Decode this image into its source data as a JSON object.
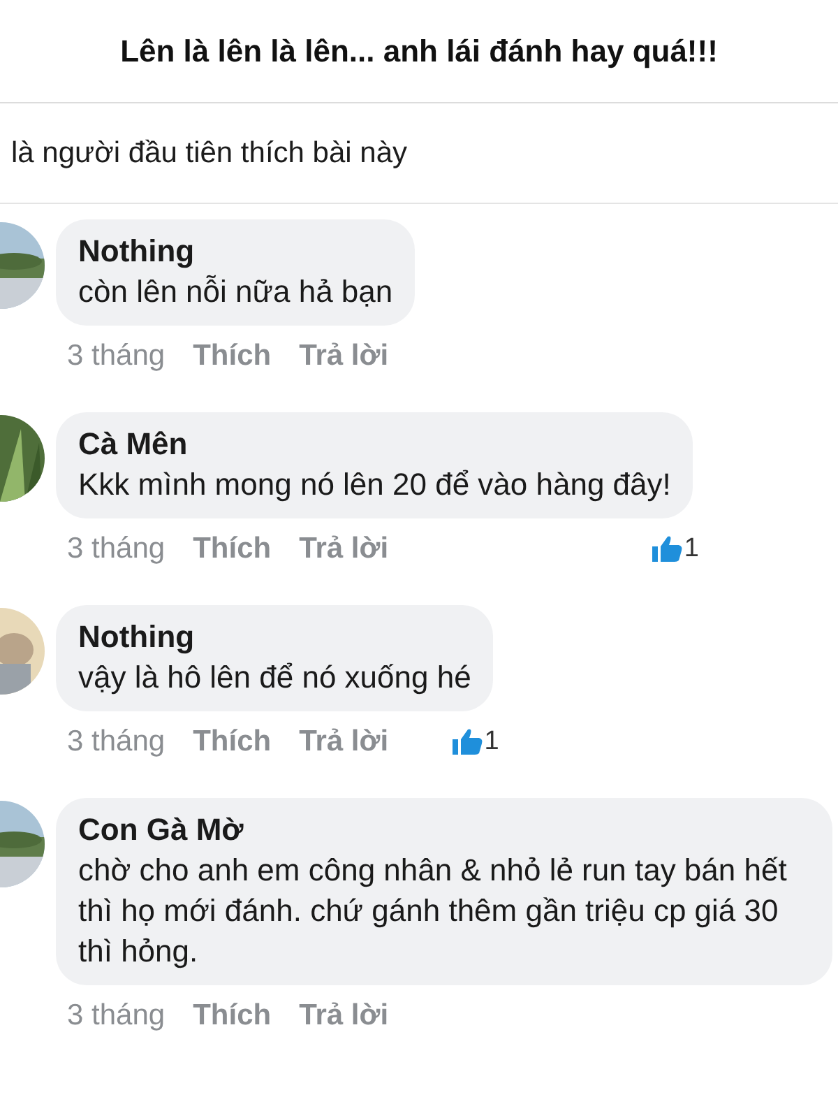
{
  "header": {
    "title": "Lên là lên là lên... anh lái đánh hay quá!!!"
  },
  "likes_note": "là người đầu tiên thích bài này",
  "comments": [
    {
      "author": "Nothing",
      "text": "còn lên nỗi nữa hả bạn",
      "time": "3 tháng",
      "like_action": "Thích",
      "reply_action": "Trả lời"
    },
    {
      "author": "Cà Mên",
      "text": "Kkk mình mong nó lên 20 để vào hàng đây!",
      "time": "3 tháng",
      "like_action": "Thích",
      "reply_action": "Trả lời",
      "reaction": {
        "count": "1"
      }
    },
    {
      "author": "Nothing",
      "text": "vậy là hô lên để nó xuống hé",
      "time": "3 tháng",
      "like_action": "Thích",
      "reply_action": "Trả lời",
      "reaction": {
        "count": "1"
      }
    },
    {
      "author": "Con Gà Mờ",
      "text": "chờ cho anh em công nhân & nhỏ lẻ run tay bán hết thì họ mới đánh. chứ gánh thêm gần triệu cp giá 30 thì hỏng.",
      "time": "3 tháng",
      "like_action": "Thích",
      "reply_action": "Trả lời"
    }
  ]
}
